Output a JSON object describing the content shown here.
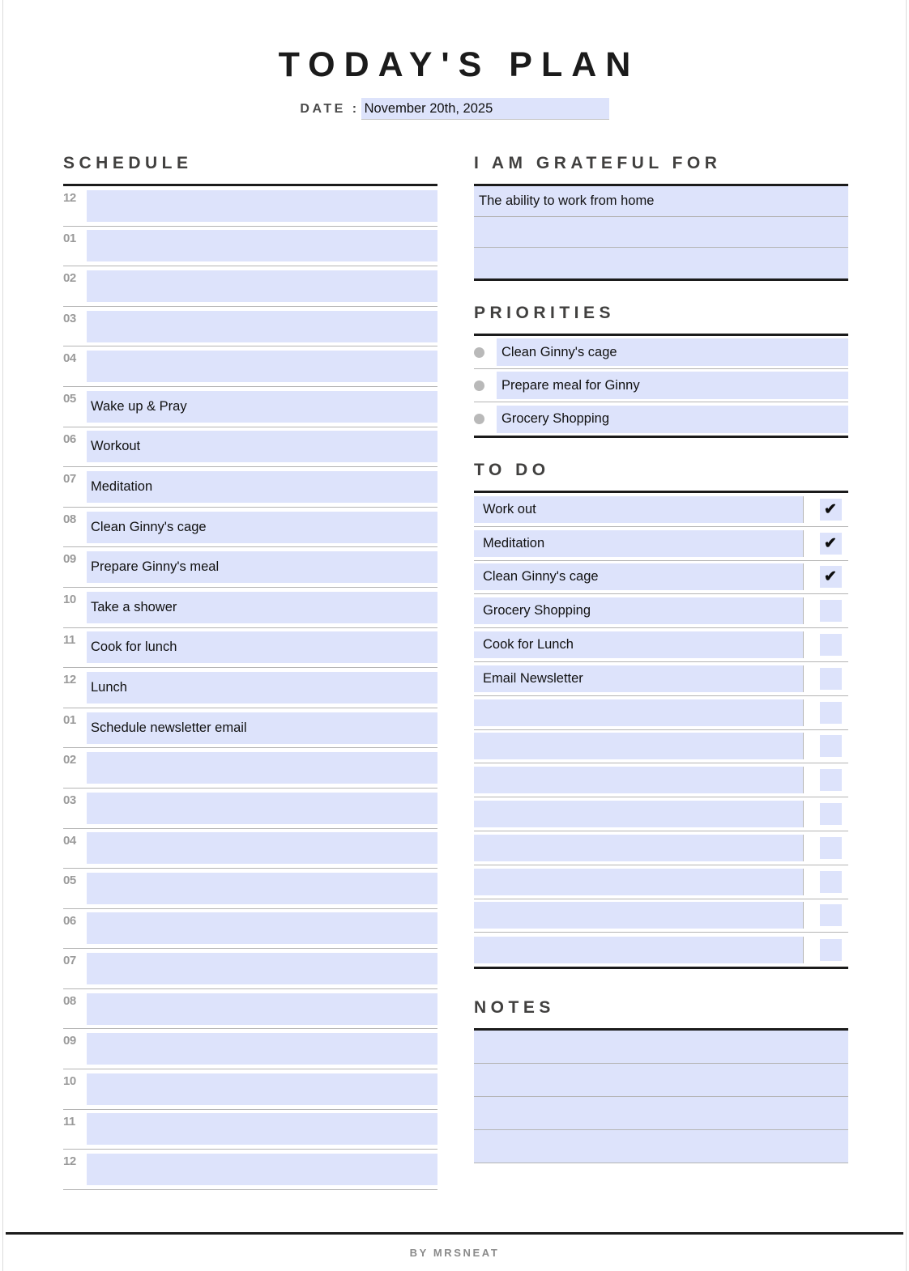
{
  "header": {
    "title": "TODAY'S PLAN",
    "date_label": "DATE :",
    "date_value": "November 20th, 2025"
  },
  "schedule": {
    "heading": "SCHEDULE",
    "rows": [
      {
        "hour": "12",
        "text": ""
      },
      {
        "hour": "01",
        "text": ""
      },
      {
        "hour": "02",
        "text": ""
      },
      {
        "hour": "03",
        "text": ""
      },
      {
        "hour": "04",
        "text": ""
      },
      {
        "hour": "05",
        "text": "Wake up & Pray"
      },
      {
        "hour": "06",
        "text": "Workout"
      },
      {
        "hour": "07",
        "text": "Meditation"
      },
      {
        "hour": "08",
        "text": "Clean Ginny's cage"
      },
      {
        "hour": "09",
        "text": "Prepare Ginny's meal"
      },
      {
        "hour": "10",
        "text": "Take a shower"
      },
      {
        "hour": "11",
        "text": "Cook for lunch"
      },
      {
        "hour": "12",
        "text": "Lunch"
      },
      {
        "hour": "01",
        "text": "Schedule newsletter email"
      },
      {
        "hour": "02",
        "text": ""
      },
      {
        "hour": "03",
        "text": ""
      },
      {
        "hour": "04",
        "text": ""
      },
      {
        "hour": "05",
        "text": ""
      },
      {
        "hour": "06",
        "text": ""
      },
      {
        "hour": "07",
        "text": ""
      },
      {
        "hour": "08",
        "text": ""
      },
      {
        "hour": "09",
        "text": ""
      },
      {
        "hour": "10",
        "text": ""
      },
      {
        "hour": "11",
        "text": ""
      },
      {
        "hour": "12",
        "text": ""
      }
    ]
  },
  "grateful": {
    "heading": "I AM GRATEFUL FOR",
    "rows": [
      {
        "text": "The ability to work from home"
      },
      {
        "text": ""
      },
      {
        "text": ""
      }
    ]
  },
  "priorities": {
    "heading": "PRIORITIES",
    "rows": [
      {
        "text": "Clean Ginny's cage"
      },
      {
        "text": "Prepare meal for Ginny"
      },
      {
        "text": "Grocery Shopping"
      }
    ]
  },
  "todo": {
    "heading": "TO DO",
    "check_glyph": "✔",
    "rows": [
      {
        "text": "Work out",
        "checked": true
      },
      {
        "text": "Meditation",
        "checked": true
      },
      {
        "text": "Clean Ginny's cage",
        "checked": true
      },
      {
        "text": "Grocery Shopping",
        "checked": false
      },
      {
        "text": "Cook for Lunch",
        "checked": false
      },
      {
        "text": "Email Newsletter",
        "checked": false
      },
      {
        "text": "",
        "checked": false
      },
      {
        "text": "",
        "checked": false
      },
      {
        "text": "",
        "checked": false
      },
      {
        "text": "",
        "checked": false
      },
      {
        "text": "",
        "checked": false
      },
      {
        "text": "",
        "checked": false
      },
      {
        "text": "",
        "checked": false
      },
      {
        "text": "",
        "checked": false
      }
    ]
  },
  "notes": {
    "heading": "NOTES",
    "rows": [
      {
        "text": ""
      },
      {
        "text": ""
      },
      {
        "text": ""
      },
      {
        "text": ""
      }
    ]
  },
  "footer": {
    "credit": "BY MRSNEAT"
  },
  "colors": {
    "field_fill": "#dde3fb",
    "rule_dark": "#1b1b1b",
    "rule_light": "#b4b4b4",
    "hour_label": "#9a9a9a",
    "bullet": "#b9b9b9"
  }
}
